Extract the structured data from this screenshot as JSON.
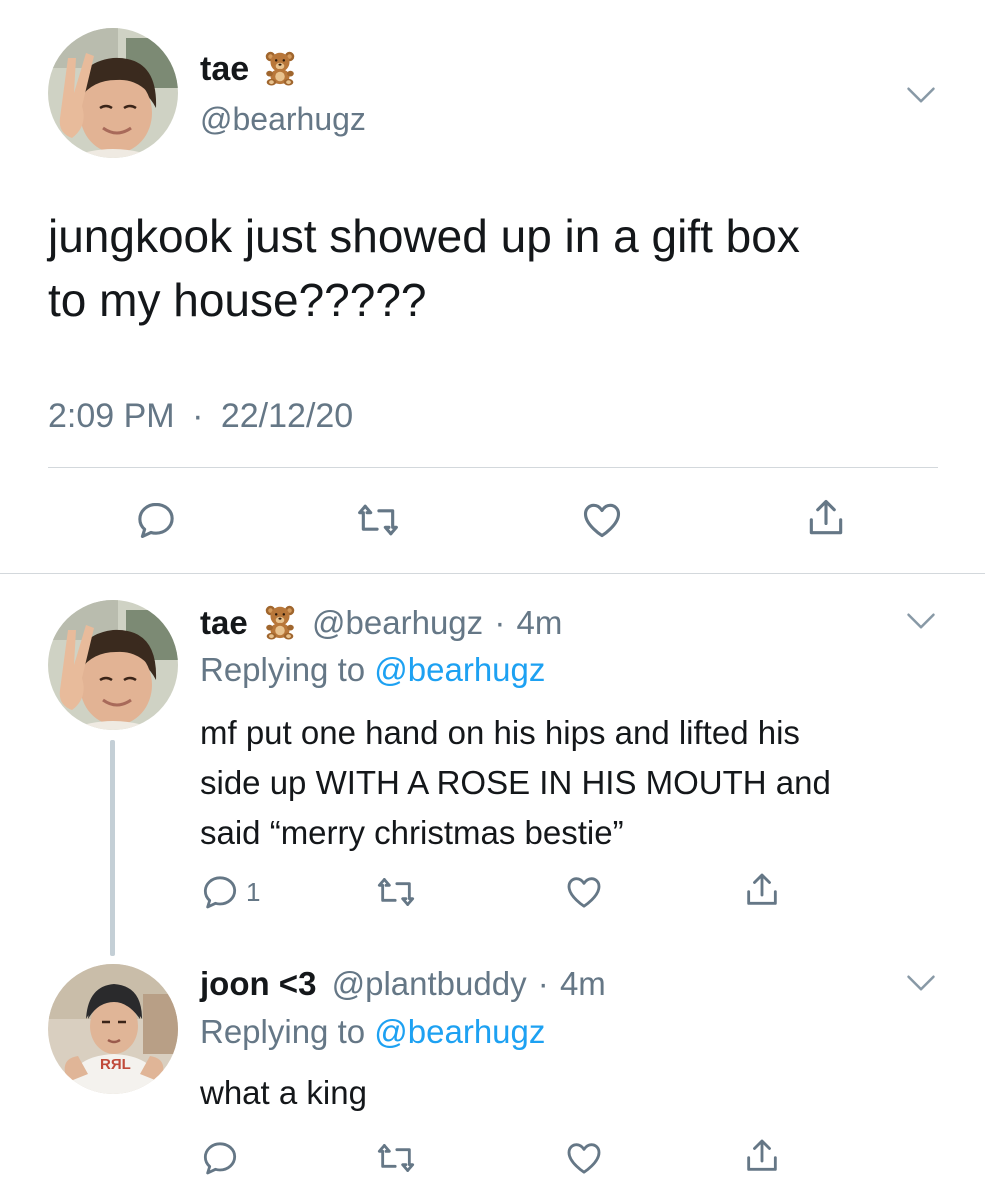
{
  "main_tweet": {
    "display_name": "tae",
    "name_emoji": "🧸",
    "handle": "@bearhugz",
    "text_line1": "jungkook just showed up in a gift box",
    "text_line2": "to my house?????",
    "time": "2:09 PM",
    "sep": "·",
    "date": "22/12/20",
    "avatar_icon": "avatar-photo-tae"
  },
  "replies": [
    {
      "display_name": "tae",
      "name_emoji": "🧸",
      "handle": "@bearhugz",
      "sep": "·",
      "age": "4m",
      "replying_prefix": "Replying to",
      "replying_to": "@bearhugz",
      "lines": [
        "mf put one hand on his hips and lifted his",
        "side up WITH A ROSE IN HIS MOUTH and",
        "said “merry christmas bestie”"
      ],
      "reply_count": "1",
      "avatar_icon": "avatar-photo-tae"
    },
    {
      "display_name": "joon <3",
      "handle": "@plantbuddy",
      "sep": "·",
      "age": "4m",
      "replying_prefix": "Replying to",
      "replying_to": "@bearhugz",
      "lines": [
        "what a king"
      ],
      "reply_count": "",
      "avatar_icon": "avatar-photo-joon",
      "shirt_text": "RЯL"
    }
  ],
  "icons": [
    "chevron-down-icon",
    "reply-icon",
    "retweet-icon",
    "like-icon",
    "share-icon"
  ],
  "colors": {
    "text": "#14171a",
    "muted": "#657786",
    "link": "#1da1f2",
    "divider": "#d3d8dc",
    "thread": "#c4cfd6"
  }
}
